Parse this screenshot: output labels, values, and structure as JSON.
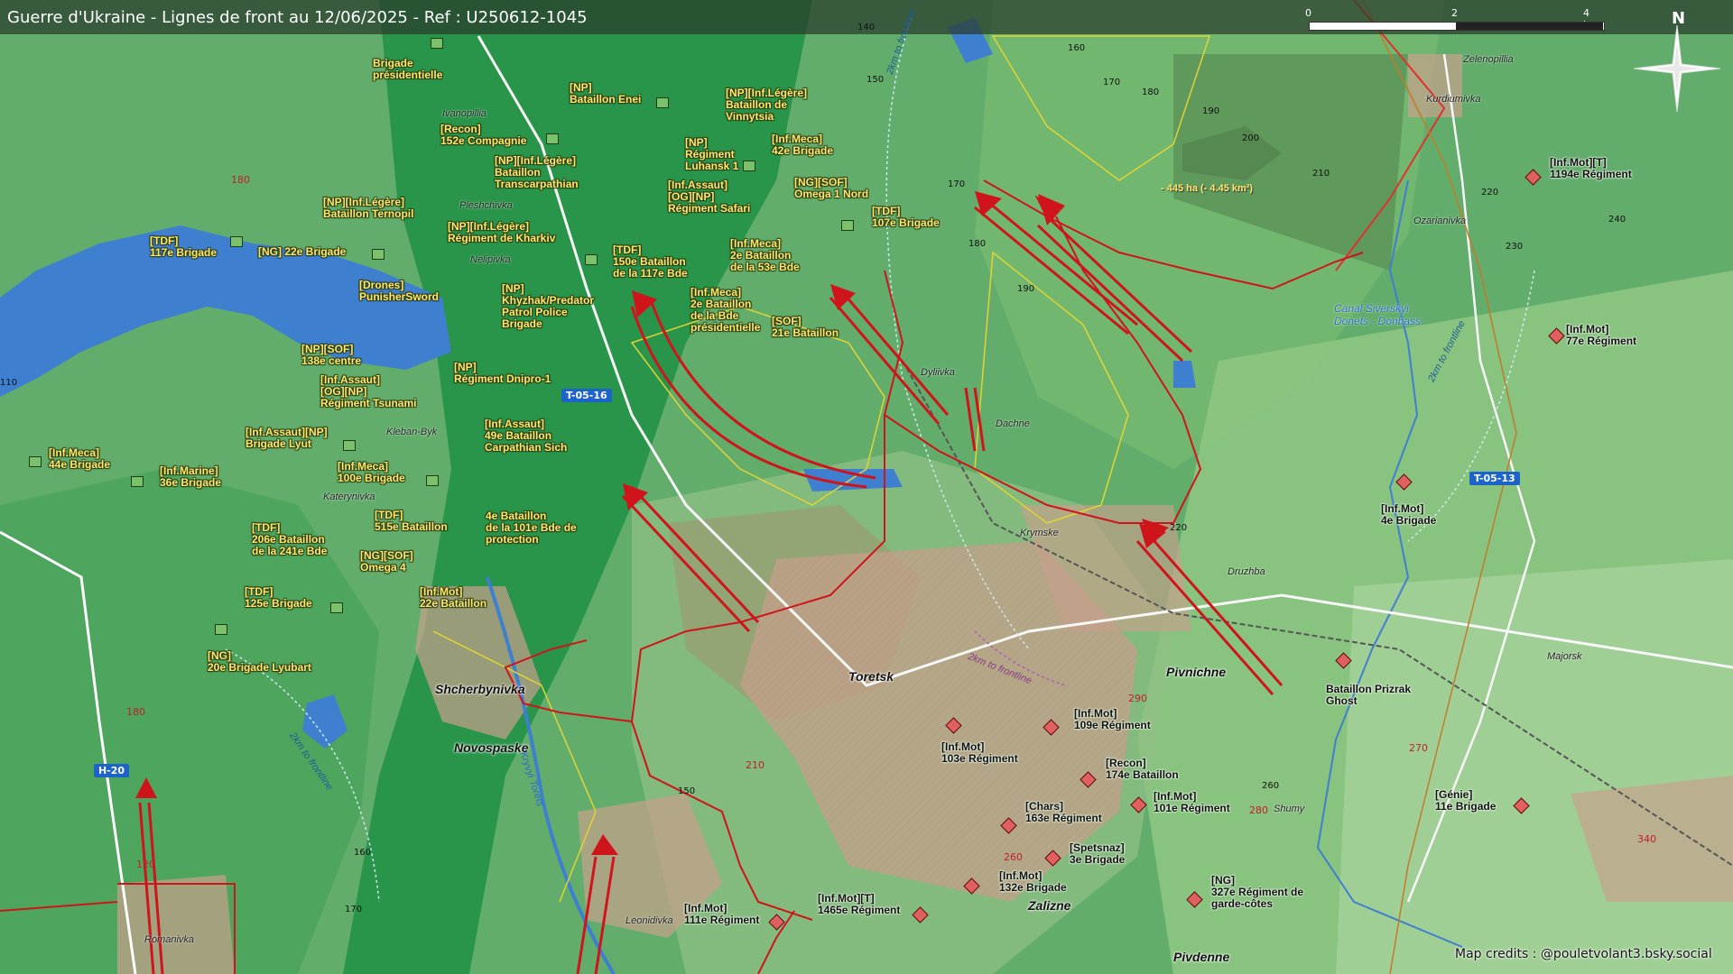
{
  "title": "Guerre d'Ukraine - Lignes de front au 12/06/2025 - Ref : U250612-1045",
  "scale": {
    "labels": [
      "0",
      "2",
      "4 km"
    ]
  },
  "north_label": "N",
  "credits": "Map credits : @pouletvolant3.bsky.social",
  "colors": {
    "frontline": "#d0141c",
    "ukraine_unit_text": "#ffe86b",
    "enemy_symbol": "#e06060",
    "water": "#3f7fd0",
    "road_shield": "#1d64c8"
  },
  "ukraine_units": [
    {
      "label": "Brigade\nprésidentielle"
    },
    {
      "label": "[NP]\nBataillon Enei"
    },
    {
      "label": "[Recon]\n152e Compagnie"
    },
    {
      "label": "[NP][Inf.Légère]\nBataillon\nTranscarpathian"
    },
    {
      "label": "[NP][Inf.Légère]\nBataillon de\nVinnytsia"
    },
    {
      "label": "[NP]\nRégiment\nLuhansk 1"
    },
    {
      "label": "[Inf.Meca]\n42e Brigade"
    },
    {
      "label": "[Inf.Assaut]\n[OG][NP]\nRégiment Safari"
    },
    {
      "label": "[NG][SOF]\nOmega 1 Nord"
    },
    {
      "label": "[TDF]\n107e Brigade"
    },
    {
      "label": "[NP][Inf.Légère]\nBataillon Ternopil"
    },
    {
      "label": "[NP][Inf.Légère]\nRégiment de Kharkiv"
    },
    {
      "label": "[TDF]\n117e Brigade"
    },
    {
      "label": "[NG] 22e Brigade"
    },
    {
      "label": "[TDF]\n150e Bataillon\nde la 117e Bde"
    },
    {
      "label": "[Inf.Meca]\n2e Bataillon\nde la 53e Bde"
    },
    {
      "label": "[Drones]\nPunisherSword"
    },
    {
      "label": "[NP]\nKhyzhak/Predator\nPatrol Police\nBrigade"
    },
    {
      "label": "[Inf.Meca]\n2e Bataillon\nde la Bde\nprésidentielle"
    },
    {
      "label": "[SOF]\n21e Bataillon"
    },
    {
      "label": "[NP][SOF]\n138e centre"
    },
    {
      "label": "[NP]\nRégiment Dnipro-1"
    },
    {
      "label": "[Inf.Assaut]\n[OG][NP]\nRégiment Tsunami"
    },
    {
      "label": "[Inf.Assaut][NP]\nBrigade Lyut"
    },
    {
      "label": "[Inf.Assaut]\n49e Bataillon\nCarpathian Sich"
    },
    {
      "label": "[Inf.Meca]\n44e Brigade"
    },
    {
      "label": "[Inf.Marine]\n36e Brigade"
    },
    {
      "label": "[Inf.Meca]\n100e Brigade"
    },
    {
      "label": "[TDF]\n515e Bataillon"
    },
    {
      "label": "4e Bataillon\nde la 101e Bde de\nprotection"
    },
    {
      "label": "[TDF]\n206e Bataillon\nde la 241e Bde"
    },
    {
      "label": "[NG][SOF]\nOmega 4"
    },
    {
      "label": "[TDF]\n125e Brigade"
    },
    {
      "label": "[Inf.Mot]\n22e Bataillon"
    },
    {
      "label": "[NG]\n20e Brigade Lyubart"
    }
  ],
  "enemy_units": [
    {
      "label": "[Inf.Mot][T]\n1194e Régiment"
    },
    {
      "label": "[Inf.Mot]\n77e Régiment"
    },
    {
      "label": "[Inf.Mot]\n4e Brigade"
    },
    {
      "label": "Bataillon Prizrak\nGhost"
    },
    {
      "label": "[Génie]\n11e Brigade"
    },
    {
      "label": "[Inf.Mot]\n109e Régiment"
    },
    {
      "label": "[Inf.Mot]\n103e Régiment"
    },
    {
      "label": "[Recon]\n174e Bataillon"
    },
    {
      "label": "[Chars]\n163e Régiment"
    },
    {
      "label": "[Inf.Mot]\n101e Régiment"
    },
    {
      "label": "[Spetsnaz]\n3e Brigade"
    },
    {
      "label": "[Inf.Mot]\n132e Brigade"
    },
    {
      "label": "[NG]\n327e Régiment de\ngarde-côtes"
    },
    {
      "label": "[Inf.Mot][T]\n1465e Régiment"
    },
    {
      "label": "[Inf.Mot]\n111e Régiment"
    }
  ],
  "towns": [
    "Toretsk",
    "Pivnichne",
    "Shcherbynivka",
    "Novospaske",
    "Zalizne",
    "Pivdenne"
  ],
  "villages": [
    "Ivanopillia",
    "Pleshchivka",
    "Nelipivka",
    "Kleban-Byk",
    "Katerynivka",
    "Dyliivka",
    "Dachne",
    "Krymske",
    "Druzhba",
    "Zelenopillia",
    "Kurdiumivka",
    "Ozarianivka",
    "Majorsk",
    "Shumy",
    "Leonidivka",
    "Romanivka"
  ],
  "roads": [
    "T-05-16",
    "T-05-13",
    "H-20"
  ],
  "elevations_black": [
    "140",
    "150",
    "160",
    "170",
    "180",
    "190",
    "200",
    "210",
    "170",
    "180",
    "190",
    "220",
    "230",
    "240",
    "220",
    "150",
    "160",
    "170",
    "260",
    "110"
  ],
  "elevations_red": [
    "180",
    "180",
    "120",
    "210",
    "290",
    "260",
    "280",
    "270",
    "340"
  ],
  "area_label": "- 445 ha (- 4.45 km²)",
  "canal_label": "Canal Siverskyi\nDonets - Donbass",
  "river_label": "Kryvyi Torets",
  "frontline_labels": [
    "2km to frontline",
    "2km to frontline",
    "2km to frontline"
  ],
  "frontline_label_purple": "2km to frontline"
}
